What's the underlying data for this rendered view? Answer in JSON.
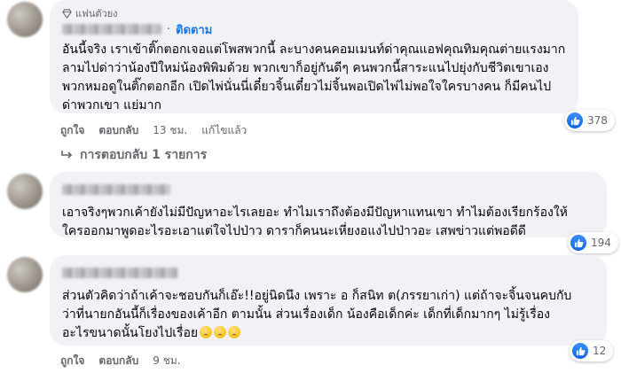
{
  "comments": [
    {
      "badge": "แฟนตัวยง",
      "follow_label": "ติดตาม",
      "separator": "·",
      "text": "อันนี้จริง เราเข้าติ๊กตอกเจอแต่โพสพวกนี้ ละบางคนคอมเมนท์ด่าคุณแอฟคุณทิมคุณต่ายแรงมาก\nลามไปด่าว่าน้องปีใหม่น้องพิพิมด้วย พวกเขาก็อยู่กันดีๆ คนพวกนี้สาระแนไปยุ่งกับชีวิตเขาเอง\nพวกหมอดูในติ๊กตอกอีก เปิดไพ่นั่นนี่เดี๋ยวจิ้นเดี๋ยวไม่จิ้นพอเปิดไพ่ไม่พอใจใครบางคน ก็มีคนไป\nด่าพวกเขา แย่มาก",
      "reaction_count": "378",
      "like_label": "ถูกใจ",
      "reply_label": "ตอบกลับ",
      "time": "13 ชม.",
      "edited": "แก้ไขแล้ว"
    },
    {
      "text": "เอาจริงๆพวกเค้ายังไม่มีปัญหาอะไรเลยอะ ทำไมเราถึงต้องมีปัญหาแทนเขา ทำไมต้องเรียกร้องให้\nใครออกมาพูดอะไรอะเอาแต่ใจไปป่าว ดาราก็คนนะเหี่ยงอแงไปป่าวอะ เสพข่าวแต่พอดีดี",
      "reaction_count": "194"
    },
    {
      "text": "ส่วนตัวคิดว่าถ้าเค้าจะชอบกันก็เอ๊ะ!!อยู่นิดนึง เพราะ อ ก็สนิท ต(ภรรยาเก่า) แต่ถ้าจะจิ้นจนคบกับ\nว่าที่นายกอันนี้ก็เรื่องของเค้าอีก ตามนั้น ส่วนเรื่องเด็ก น้องคือเด็กค่ะ เด็กที่เด็กมากๆ ไม่รู้เรื่อง\nอะไรขนาดนั้นโยงไปเรื่อย",
      "emoji_count": 3,
      "reaction_count": "12",
      "like_label": "ถูกใจ",
      "reply_label": "ตอบกลับ",
      "time": "9 ชม."
    }
  ],
  "replies_link": "การตอบกลับ 1 รายการ",
  "colors": {
    "accent": "#1877f2",
    "bubble": "#f0f2f5",
    "muted": "#65676b"
  },
  "icons": [
    "fan-diamond-icon",
    "like-icon",
    "reply-arrow-icon"
  ]
}
